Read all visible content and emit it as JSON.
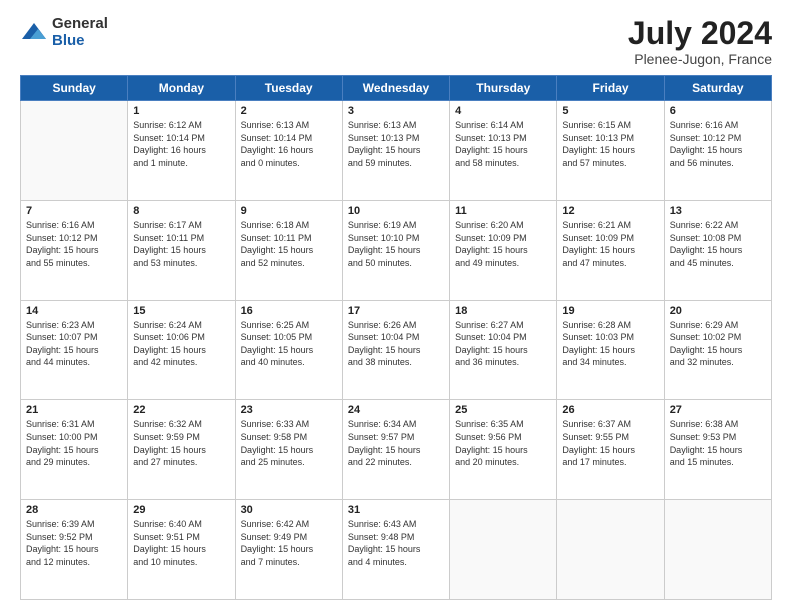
{
  "logo": {
    "general": "General",
    "blue": "Blue"
  },
  "header": {
    "month": "July 2024",
    "location": "Plenee-Jugon, France"
  },
  "days": [
    "Sunday",
    "Monday",
    "Tuesday",
    "Wednesday",
    "Thursday",
    "Friday",
    "Saturday"
  ],
  "weeks": [
    [
      {
        "day": "",
        "info": ""
      },
      {
        "day": "1",
        "info": "Sunrise: 6:12 AM\nSunset: 10:14 PM\nDaylight: 16 hours\nand 1 minute."
      },
      {
        "day": "2",
        "info": "Sunrise: 6:13 AM\nSunset: 10:14 PM\nDaylight: 16 hours\nand 0 minutes."
      },
      {
        "day": "3",
        "info": "Sunrise: 6:13 AM\nSunset: 10:13 PM\nDaylight: 15 hours\nand 59 minutes."
      },
      {
        "day": "4",
        "info": "Sunrise: 6:14 AM\nSunset: 10:13 PM\nDaylight: 15 hours\nand 58 minutes."
      },
      {
        "day": "5",
        "info": "Sunrise: 6:15 AM\nSunset: 10:13 PM\nDaylight: 15 hours\nand 57 minutes."
      },
      {
        "day": "6",
        "info": "Sunrise: 6:16 AM\nSunset: 10:12 PM\nDaylight: 15 hours\nand 56 minutes."
      }
    ],
    [
      {
        "day": "7",
        "info": "Sunrise: 6:16 AM\nSunset: 10:12 PM\nDaylight: 15 hours\nand 55 minutes."
      },
      {
        "day": "8",
        "info": "Sunrise: 6:17 AM\nSunset: 10:11 PM\nDaylight: 15 hours\nand 53 minutes."
      },
      {
        "day": "9",
        "info": "Sunrise: 6:18 AM\nSunset: 10:11 PM\nDaylight: 15 hours\nand 52 minutes."
      },
      {
        "day": "10",
        "info": "Sunrise: 6:19 AM\nSunset: 10:10 PM\nDaylight: 15 hours\nand 50 minutes."
      },
      {
        "day": "11",
        "info": "Sunrise: 6:20 AM\nSunset: 10:09 PM\nDaylight: 15 hours\nand 49 minutes."
      },
      {
        "day": "12",
        "info": "Sunrise: 6:21 AM\nSunset: 10:09 PM\nDaylight: 15 hours\nand 47 minutes."
      },
      {
        "day": "13",
        "info": "Sunrise: 6:22 AM\nSunset: 10:08 PM\nDaylight: 15 hours\nand 45 minutes."
      }
    ],
    [
      {
        "day": "14",
        "info": "Sunrise: 6:23 AM\nSunset: 10:07 PM\nDaylight: 15 hours\nand 44 minutes."
      },
      {
        "day": "15",
        "info": "Sunrise: 6:24 AM\nSunset: 10:06 PM\nDaylight: 15 hours\nand 42 minutes."
      },
      {
        "day": "16",
        "info": "Sunrise: 6:25 AM\nSunset: 10:05 PM\nDaylight: 15 hours\nand 40 minutes."
      },
      {
        "day": "17",
        "info": "Sunrise: 6:26 AM\nSunset: 10:04 PM\nDaylight: 15 hours\nand 38 minutes."
      },
      {
        "day": "18",
        "info": "Sunrise: 6:27 AM\nSunset: 10:04 PM\nDaylight: 15 hours\nand 36 minutes."
      },
      {
        "day": "19",
        "info": "Sunrise: 6:28 AM\nSunset: 10:03 PM\nDaylight: 15 hours\nand 34 minutes."
      },
      {
        "day": "20",
        "info": "Sunrise: 6:29 AM\nSunset: 10:02 PM\nDaylight: 15 hours\nand 32 minutes."
      }
    ],
    [
      {
        "day": "21",
        "info": "Sunrise: 6:31 AM\nSunset: 10:00 PM\nDaylight: 15 hours\nand 29 minutes."
      },
      {
        "day": "22",
        "info": "Sunrise: 6:32 AM\nSunset: 9:59 PM\nDaylight: 15 hours\nand 27 minutes."
      },
      {
        "day": "23",
        "info": "Sunrise: 6:33 AM\nSunset: 9:58 PM\nDaylight: 15 hours\nand 25 minutes."
      },
      {
        "day": "24",
        "info": "Sunrise: 6:34 AM\nSunset: 9:57 PM\nDaylight: 15 hours\nand 22 minutes."
      },
      {
        "day": "25",
        "info": "Sunrise: 6:35 AM\nSunset: 9:56 PM\nDaylight: 15 hours\nand 20 minutes."
      },
      {
        "day": "26",
        "info": "Sunrise: 6:37 AM\nSunset: 9:55 PM\nDaylight: 15 hours\nand 17 minutes."
      },
      {
        "day": "27",
        "info": "Sunrise: 6:38 AM\nSunset: 9:53 PM\nDaylight: 15 hours\nand 15 minutes."
      }
    ],
    [
      {
        "day": "28",
        "info": "Sunrise: 6:39 AM\nSunset: 9:52 PM\nDaylight: 15 hours\nand 12 minutes."
      },
      {
        "day": "29",
        "info": "Sunrise: 6:40 AM\nSunset: 9:51 PM\nDaylight: 15 hours\nand 10 minutes."
      },
      {
        "day": "30",
        "info": "Sunrise: 6:42 AM\nSunset: 9:49 PM\nDaylight: 15 hours\nand 7 minutes."
      },
      {
        "day": "31",
        "info": "Sunrise: 6:43 AM\nSunset: 9:48 PM\nDaylight: 15 hours\nand 4 minutes."
      },
      {
        "day": "",
        "info": ""
      },
      {
        "day": "",
        "info": ""
      },
      {
        "day": "",
        "info": ""
      }
    ]
  ]
}
